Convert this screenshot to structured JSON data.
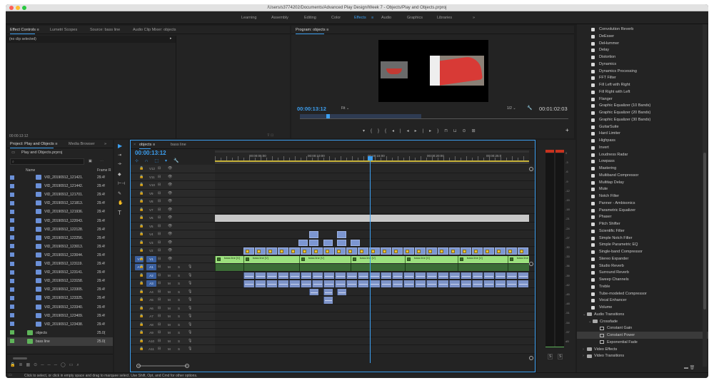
{
  "window": {
    "title": "/Users/s3774202/Documents/Advanced Play Design/Week 7 - Objects/Play and Objects.prproj"
  },
  "workspaces": {
    "items": [
      "Learning",
      "Assembly",
      "Editing",
      "Color",
      "Effects",
      "Audio",
      "Graphics",
      "Libraries"
    ],
    "active": "Effects",
    "more": "»"
  },
  "effect_controls": {
    "tabs": [
      "Effect Controls",
      "Lumetri Scopes",
      "Source: bass line",
      "Audio Clip Mixer: objects"
    ],
    "no_clip": "(no clip selected)",
    "timecode": "00:00:13:12"
  },
  "program": {
    "title": "Program: objects",
    "timecode": "00:00:13:12",
    "fit": "Fit",
    "resolution": "1/2",
    "duration": "00:01:02:03"
  },
  "project": {
    "tabs": [
      "Project: Play and Objects",
      "Media Browser"
    ],
    "file": "Play and Objects.prproj",
    "columns": {
      "name": "Name",
      "frame": "Frame R"
    },
    "items": [
      {
        "name": "VID_20190912_121421.",
        "fps": "29.4!",
        "color": "#6b90d8",
        "type": "clip"
      },
      {
        "name": "VID_20190912_121442.",
        "fps": "29.4!",
        "color": "#6b90d8",
        "type": "clip"
      },
      {
        "name": "VID_20190912_121701.",
        "fps": "29.4!",
        "color": "#6b90d8",
        "type": "clip"
      },
      {
        "name": "VID_20190912_121813.",
        "fps": "29.4!",
        "color": "#6b90d8",
        "type": "clip"
      },
      {
        "name": "VID_20190912_121936.",
        "fps": "29.4!",
        "color": "#6b90d8",
        "type": "clip"
      },
      {
        "name": "VID_20190912_122043.",
        "fps": "29.4!",
        "color": "#6b90d8",
        "type": "clip"
      },
      {
        "name": "VID_20190912_122128.",
        "fps": "29.4!",
        "color": "#6b90d8",
        "type": "clip"
      },
      {
        "name": "VID_20190912_122256.",
        "fps": "29.4!",
        "color": "#6b90d8",
        "type": "clip"
      },
      {
        "name": "VID_20190912_123013.",
        "fps": "29.4!",
        "color": "#6b90d8",
        "type": "clip"
      },
      {
        "name": "VID_20190912_123044.",
        "fps": "29.4!",
        "color": "#6b90d8",
        "type": "clip"
      },
      {
        "name": "VID_20190912_123119.",
        "fps": "29.4!",
        "color": "#6b90d8",
        "type": "clip"
      },
      {
        "name": "VID_20190912_123141.",
        "fps": "29.4!",
        "color": "#6b90d8",
        "type": "clip"
      },
      {
        "name": "VID_20190912_123158.",
        "fps": "29.4!",
        "color": "#6b90d8",
        "type": "clip"
      },
      {
        "name": "VID_20190912_123305.",
        "fps": "29.4!",
        "color": "#6b90d8",
        "type": "clip"
      },
      {
        "name": "VID_20190912_123325.",
        "fps": "29.4!",
        "color": "#6b90d8",
        "type": "clip"
      },
      {
        "name": "VID_20190912_123340.",
        "fps": "29.4!",
        "color": "#6b90d8",
        "type": "clip"
      },
      {
        "name": "VID_20190912_123409.",
        "fps": "29.4!",
        "color": "#6b90d8",
        "type": "clip"
      },
      {
        "name": "VID_20190912_123438.",
        "fps": "29.4!",
        "color": "#6b90d8",
        "type": "clip"
      },
      {
        "name": "objects",
        "fps": "25.0(",
        "color": "#5fb55a",
        "type": "seq"
      },
      {
        "name": "bass line",
        "fps": "25.0(",
        "color": "#5fb55a",
        "type": "seq"
      }
    ]
  },
  "timeline": {
    "tabs": [
      "objects",
      "bass line"
    ],
    "timecode": "00:00:13:12",
    "ruler": [
      "00:00:05:00",
      "00:00:10:00",
      "00:00:15:00",
      "00:00:20:00",
      "00:00:25:0"
    ],
    "video_tracks": [
      "V12",
      "V11",
      "V10",
      "V9",
      "V8",
      "V7",
      "V6",
      "V5",
      "V4",
      "V3",
      "V2",
      "V1"
    ],
    "audio_tracks": [
      "A1",
      "A2",
      "A3",
      "A4",
      "A5",
      "A6",
      "A7",
      "A8",
      "A9",
      "A10",
      "A11"
    ],
    "source_v": "V1",
    "source_a": "A1",
    "clip_label": "bass line [V]",
    "m": "M",
    "s": "S"
  },
  "meter": {
    "scale": [
      "0",
      "-3",
      "-6",
      "-9",
      "-12",
      "-15",
      "-18",
      "-21",
      "-24",
      "-27",
      "-30",
      "-33",
      "-36",
      "-39",
      "-42",
      "-45",
      "-48",
      "-51",
      "-54",
      "-57",
      "dB"
    ],
    "s1": "S",
    "s2": "S"
  },
  "effects": {
    "audio_items": [
      "Convolution Reverb",
      "DeEsser",
      "DeHummer",
      "Delay",
      "Distortion",
      "Dynamics",
      "Dynamics Processing",
      "FFT Filter",
      "Fill Left with Right",
      "Fill Right with Left",
      "Flanger",
      "Graphic Equalizer (10 Bands)",
      "Graphic Equalizer (20 Bands)",
      "Graphic Equalizer (30 Bands)",
      "GuitarSuite",
      "Hard Limiter",
      "Highpass",
      "Invert",
      "Loudness Radar",
      "Lowpass",
      "Mastering",
      "Multiband Compressor",
      "Multitap Delay",
      "Mute",
      "Notch Filter",
      "Panner - Ambisonics",
      "Parametric Equalizer",
      "Phaser",
      "Pitch Shifter",
      "Scientific Filter",
      "Simple Notch Filter",
      "Simple Parametric EQ",
      "Single-band Compressor",
      "Stereo Expander",
      "Studio Reverb",
      "Surround Reverb",
      "Sweep Channels",
      "Treble",
      "Tube-modeled Compressor",
      "Vocal Enhancer",
      "Volume"
    ],
    "audio_transitions": "Audio Transitions",
    "crossfade": "Crossfade",
    "crossfade_items": [
      "Constant Gain",
      "Constant Power",
      "Exponential Fade"
    ],
    "selected": "Constant Power",
    "video_effects": "Video Effects",
    "video_transitions": "Video Transitions"
  },
  "status": {
    "text": "Click to select, or click in empty space and drag to marquee select. Use Shift, Opt, and Cmd for other options."
  }
}
